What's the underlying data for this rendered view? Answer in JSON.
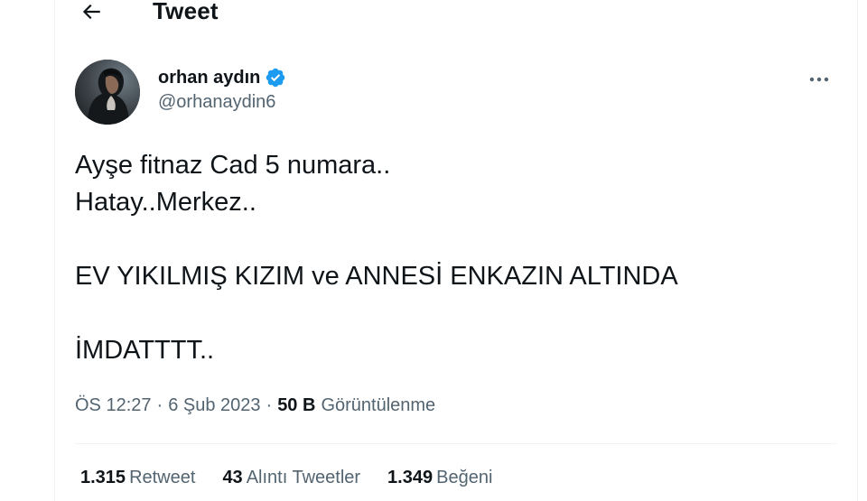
{
  "header": {
    "title": "Tweet",
    "back_icon": "arrow-left-icon"
  },
  "author": {
    "display_name": "orhan aydın",
    "handle": "@orhanaydin6",
    "verified_icon": "verified-badge-icon",
    "verified_color": "#1d9bf0"
  },
  "more_icon": "more-horizontal-icon",
  "tweet": {
    "lines": [
      "Ayşe fitnaz Cad 5 numara..",
      "Hatay..Merkez..",
      "",
      "EV YIKILMIŞ KIZIM ve ANNESİ ENKAZIN ALTINDA",
      "",
      "İMDATTTT.."
    ]
  },
  "meta": {
    "time": "ÖS 12:27",
    "separator": "·",
    "date": "6 Şub 2023",
    "views_count": "50 B",
    "views_label": "Görüntülenme"
  },
  "stats": {
    "retweets_count": "1.315",
    "retweets_label": "Retweet",
    "quotes_count": "43",
    "quotes_label": "Alıntı Tweetler",
    "likes_count": "1.349",
    "likes_label": "Beğeni"
  },
  "colors": {
    "text_primary": "#0f1419",
    "text_secondary": "#536471",
    "border": "#eff3f4"
  }
}
